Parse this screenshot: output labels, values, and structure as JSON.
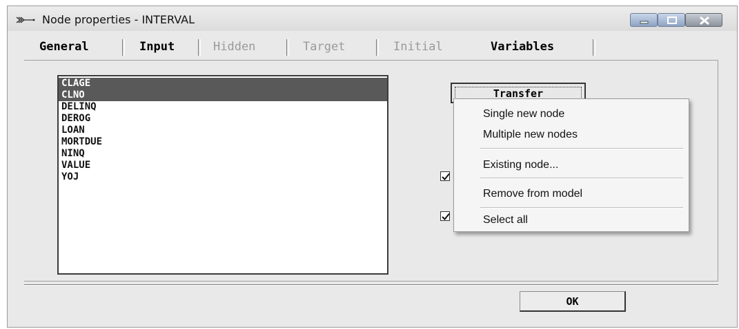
{
  "window": {
    "title": "Node properties - INTERVAL"
  },
  "tabs": [
    {
      "label": "General",
      "enabled": true
    },
    {
      "label": "Input",
      "enabled": true
    },
    {
      "label": "Hidden",
      "enabled": false
    },
    {
      "label": "Target",
      "enabled": false
    },
    {
      "label": "Initial",
      "enabled": false
    },
    {
      "label": "Variables",
      "enabled": true,
      "active": true
    }
  ],
  "variables": {
    "items": [
      "CLAGE",
      "CLNO",
      "DELINQ",
      "DEROG",
      "LOAN",
      "MORTDUE",
      "NINQ",
      "VALUE",
      "YOJ"
    ],
    "selected": [
      "CLAGE",
      "CLNO"
    ]
  },
  "transfer_button": {
    "label": "Transfer"
  },
  "context_menu": {
    "items": [
      "Single new node",
      "Multiple new nodes",
      "Existing node...",
      "Remove from model",
      "Select all"
    ]
  },
  "checkboxes": [
    {
      "checked": true
    },
    {
      "checked": true
    }
  ],
  "ok_button": {
    "label": "OK"
  },
  "colors": {
    "selection": "#595959",
    "dialog_bg": "#e9e9e9",
    "titlebar_buttons": "#8ea3c3"
  }
}
